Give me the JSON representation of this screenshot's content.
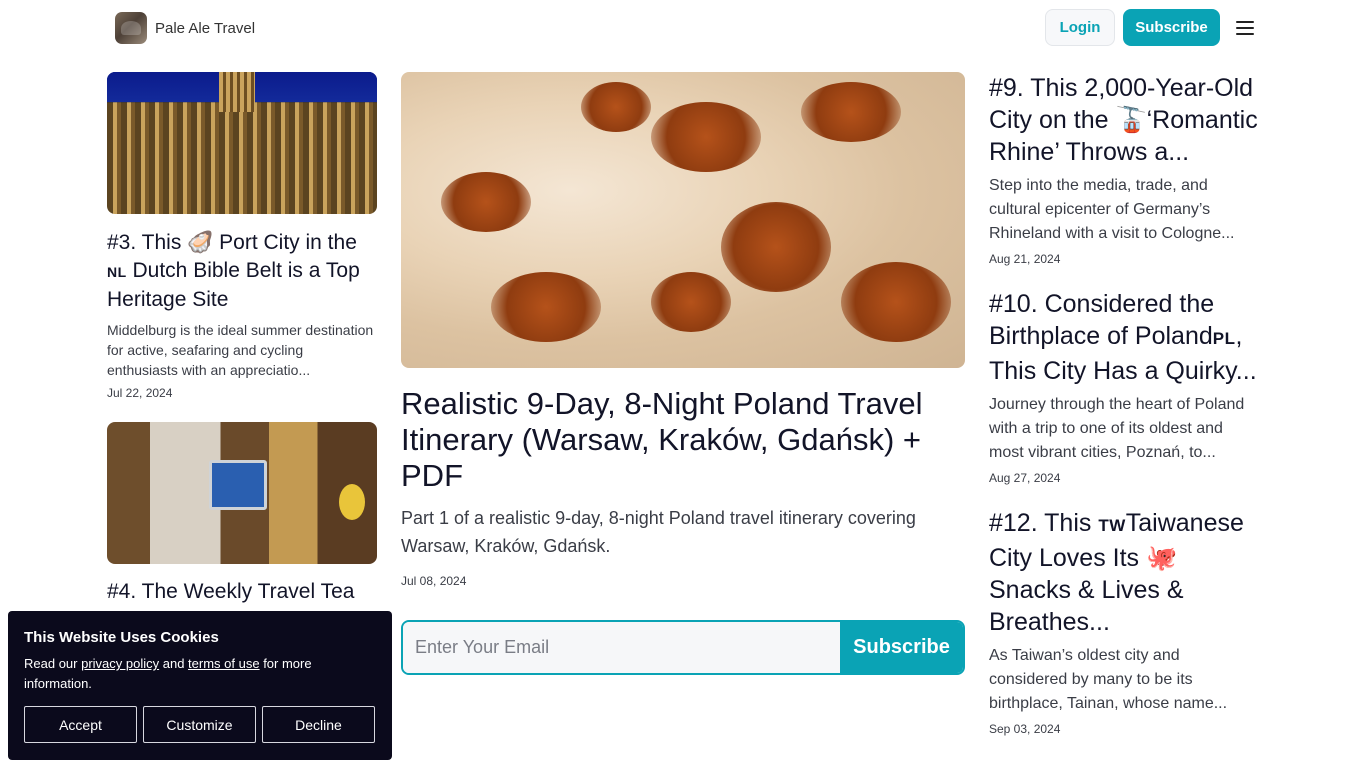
{
  "header": {
    "brand": "Pale Ale Travel",
    "login": "Login",
    "subscribe": "Subscribe"
  },
  "left": [
    {
      "title_prefix": "#3. This ",
      "title_emoji": "🦪",
      "title_mid": " Port City in the ",
      "flag": "NL",
      "title_suffix": " Dutch Bible Belt is a Top Heritage Site",
      "desc": "Middelburg is the ideal summer destination for active, seafaring and cycling enthusiasts with an appreciatio...",
      "date": "Jul 22, 2024"
    },
    {
      "title": "#4. The Weekly Travel Tea"
    }
  ],
  "center": {
    "title": "Realistic 9-Day, 8-Night Poland Travel Itinerary (Warsaw, Kraków, Gdańsk) + PDF",
    "desc": "Part 1 of a realistic 9-day, 8-night Poland travel itinerary covering Warsaw, Kraków, Gdańsk.",
    "date": "Jul 08, 2024",
    "email_placeholder": "Enter Your Email",
    "subscribe": "Subscribe"
  },
  "right": [
    {
      "title_prefix": "#9. This 2,000-Year-Old City on the ",
      "title_emoji": "🚡",
      "title_suffix": "‘Romantic Rhine’ Throws a...",
      "desc": "Step into the media, trade, and cultural epicenter of Germany’s Rhineland with a visit to Cologne...",
      "date": "Aug 21, 2024"
    },
    {
      "title_prefix": "#10. Considered the Birthplace of Poland",
      "flag": "PL",
      "title_suffix": ", This City Has a Quirky...",
      "desc": "Journey through the heart of Poland with a trip to one of its oldest and most vibrant cities, Poznań, to...",
      "date": "Aug 27, 2024"
    },
    {
      "title_prefix": "#12. This ",
      "flag": "TW",
      "title_mid": "Taiwanese City Loves Its ",
      "title_emoji": "🐙",
      "title_suffix": " Snacks & Lives & Breathes...",
      "desc": "As Taiwan’s oldest city and considered by many to be its birthplace, Tainan, whose name...",
      "date": "Sep 03, 2024"
    }
  ],
  "cookie": {
    "title": "This Website Uses Cookies",
    "text_before": "Read our ",
    "privacy": "privacy policy",
    "text_and": " and ",
    "terms": "terms of use",
    "text_after": " for more information.",
    "accept": "Accept",
    "customize": "Customize",
    "decline": "Decline"
  }
}
